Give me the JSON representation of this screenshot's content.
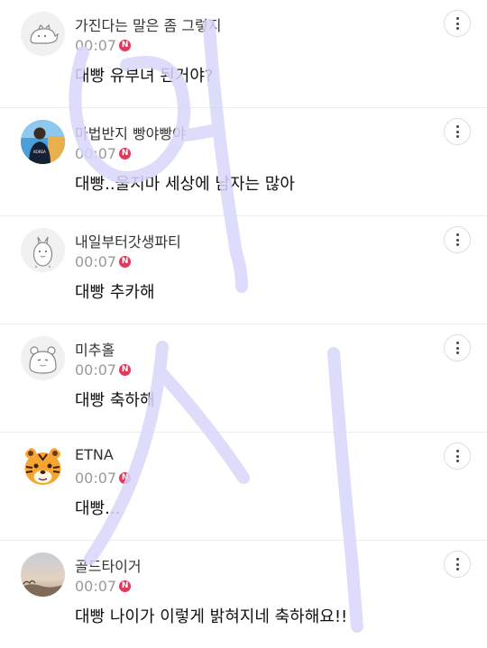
{
  "comments": [
    {
      "nickname": "가진다는 말은 좀 그렇지",
      "time": "00:07",
      "new_badge": "N",
      "text": "대빵 유부녀 된거야?",
      "avatar": "sketch-animal-avatar"
    },
    {
      "nickname": "마법반지 빵야빵야",
      "time": "00:07",
      "new_badge": "N",
      "text": "대빵..울지마 세상에 남자는 많아",
      "avatar": "person-photo-avatar"
    },
    {
      "nickname": "내일부터갓생파티",
      "time": "00:07",
      "new_badge": "N",
      "text": "대빵 추카해",
      "avatar": "sketch-bunny-avatar"
    },
    {
      "nickname": "미추홀",
      "time": "00:07",
      "new_badge": "N",
      "text": "대빵 축하해",
      "avatar": "sketch-bear-avatar"
    },
    {
      "nickname": "ETNA",
      "time": "00:07",
      "new_badge": "N",
      "text": "대빵...",
      "avatar": "tiger-emoji-avatar"
    },
    {
      "nickname": "골드타이거",
      "time": "00:07",
      "new_badge": "N",
      "text": "대빵 나이가 이렇게 밝혀지네 축하해요!!",
      "avatar": "sunset-photo-avatar"
    }
  ],
  "colors": {
    "new_badge": "#e0395c",
    "watermark": "#d8d6fb",
    "divider": "#ededed"
  }
}
